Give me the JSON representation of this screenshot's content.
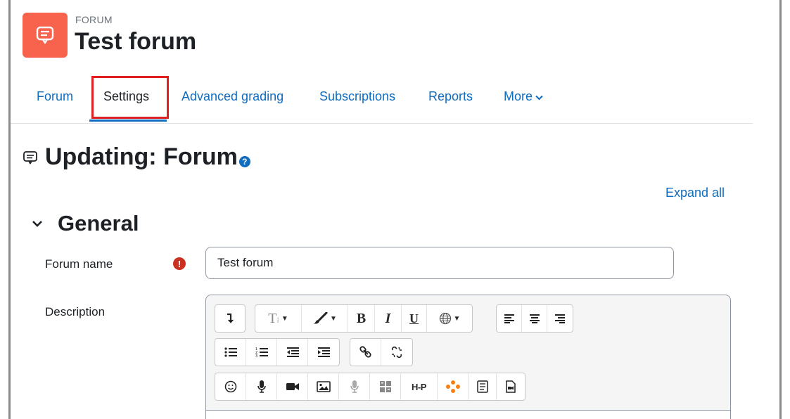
{
  "header": {
    "module_type": "FORUM",
    "title": "Test forum"
  },
  "tabs": [
    {
      "label": "Forum"
    },
    {
      "label": "Settings"
    },
    {
      "label": "Advanced grading"
    },
    {
      "label": "Subscriptions"
    },
    {
      "label": "Reports"
    },
    {
      "label": "More"
    }
  ],
  "page": {
    "heading": "Updating: Forum",
    "help_symbol": "?",
    "expand_all": "Expand all"
  },
  "general": {
    "title": "General",
    "forum_name_label": "Forum name",
    "forum_name_value": "Test forum",
    "required_symbol": "!",
    "description_label": "Description"
  },
  "toolbar": {
    "bold": "B",
    "italic": "I",
    "underline": "U",
    "h5p": "H-P"
  },
  "colors": {
    "accent": "#0f6cbf",
    "module_icon": "#f7634d",
    "highlight": "#e02020",
    "required": "#ca3120"
  }
}
